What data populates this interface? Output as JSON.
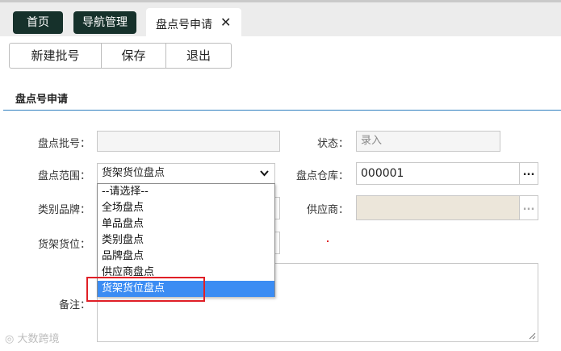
{
  "tabs": {
    "home": "首页",
    "nav": "导航管理",
    "active": "盘点号申请",
    "close_glyph": "✕"
  },
  "toolbar": {
    "new_batch": "新建批号",
    "save": "保存",
    "exit": "退出"
  },
  "section": {
    "title": "盘点号申请"
  },
  "form": {
    "batch_label": "盘点批号：",
    "batch_value": "",
    "status_label": "状态：",
    "status_value": "录入",
    "scope_label": "盘点范围：",
    "scope_value": "货架货位盘点",
    "warehouse_label": "盘点仓库：",
    "warehouse_value": "000001",
    "category_label": "类别品牌：",
    "supplier_label": "供应商：",
    "shelf_label": "货架货位：",
    "remark_label": "备注：",
    "ellipsis": "..."
  },
  "dropdown": {
    "options": [
      "--请选择--",
      "全场盘点",
      "单品盘点",
      "类别盘点",
      "品牌盘点",
      "供应商盘点",
      "货架货位盘点"
    ],
    "selected": "货架货位盘点"
  },
  "watermark": "大数跨境",
  "colors": {
    "tab_dark": "#16312b",
    "accent_line": "#2f7fbf",
    "selected_option": "#3b8cf3",
    "highlight_box": "#e01f26"
  }
}
